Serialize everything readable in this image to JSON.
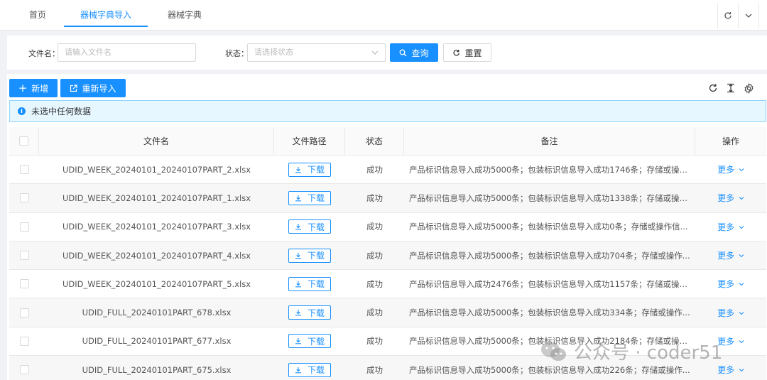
{
  "tabs": [
    {
      "label": "首页",
      "active": false
    },
    {
      "label": "器械字典导入",
      "active": true
    },
    {
      "label": "器械字典",
      "active": false
    }
  ],
  "search": {
    "file_label": "文件名：",
    "file_placeholder": "请输入文件名",
    "status_label": "状态：",
    "status_placeholder": "请选择状态",
    "query_label": "查询",
    "reset_label": "重置"
  },
  "toolbar": {
    "add_label": "新增",
    "reimport_label": "重新导入"
  },
  "alert": {
    "text": "未选中任何数据"
  },
  "table": {
    "columns": [
      "文件名",
      "文件路径",
      "状态",
      "备注",
      "操作"
    ],
    "download_label": "下载",
    "more_label": "更多",
    "rows": [
      {
        "file": "UDID_WEEK_20240101_20240107PART_2.xlsx",
        "status": "成功",
        "remark": "产品标识信息导入成功5000条；包装标识信息导入成功1746条；存储或操作..."
      },
      {
        "file": "UDID_WEEK_20240101_20240107PART_1.xlsx",
        "status": "成功",
        "remark": "产品标识信息导入成功5000条；包装标识信息导入成功1338条；存储或操作..."
      },
      {
        "file": "UDID_WEEK_20240101_20240107PART_3.xlsx",
        "status": "成功",
        "remark": "产品标识信息导入成功5000条；包装标识信息导入成功0条；存储或操作信..."
      },
      {
        "file": "UDID_WEEK_20240101_20240107PART_4.xlsx",
        "status": "成功",
        "remark": "产品标识信息导入成功5000条；包装标识信息导入成功704条；存储或操作..."
      },
      {
        "file": "UDID_WEEK_20240101_20240107PART_5.xlsx",
        "status": "成功",
        "remark": "产品标识信息导入成功2476条；包装标识信息导入成功1157条；存储或操作..."
      },
      {
        "file": "UDID_FULL_20240101PART_678.xlsx",
        "status": "成功",
        "remark": "产品标识信息导入成功5000条；包装标识信息导入成功334条；存储或操作..."
      },
      {
        "file": "UDID_FULL_20240101PART_677.xlsx",
        "status": "成功",
        "remark": "产品标识信息导入成功5000条；包装标识信息导入成功2184条；存储或操作..."
      },
      {
        "file": "UDID_FULL_20240101PART_675.xlsx",
        "status": "成功",
        "remark": "产品标识信息导入成功5000条；包装标识信息导入成功226条；存储或操作..."
      }
    ]
  },
  "watermark": {
    "text": "公众号 · coder51"
  },
  "colors": {
    "primary": "#1890ff",
    "alert_bg": "#e6f7ff"
  }
}
